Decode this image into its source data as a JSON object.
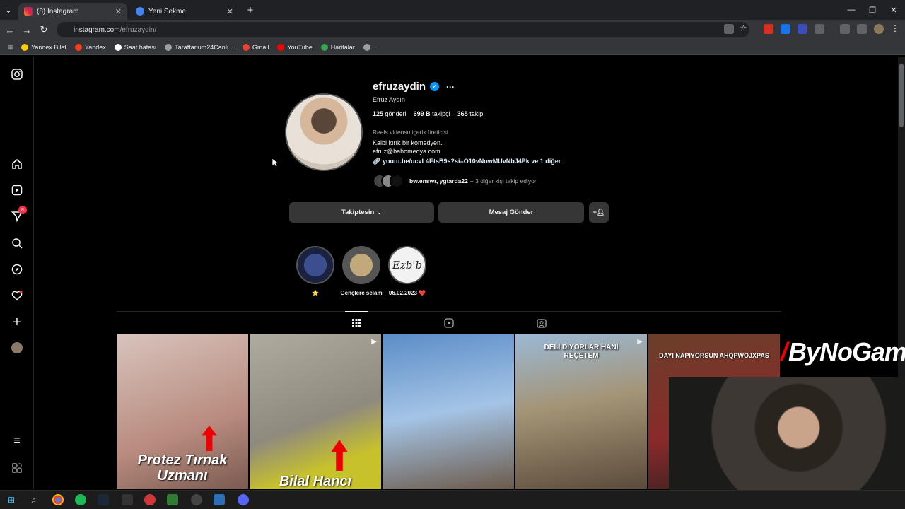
{
  "browser": {
    "tabs": [
      {
        "title": "(8) Instagram",
        "active": true
      },
      {
        "title": "Yeni Sekme",
        "active": false
      }
    ],
    "url_host": "instagram.com",
    "url_path": "/efruzaydin/",
    "bookmarks": [
      "Yandex.Bilet",
      "Yandex",
      "Saat hatası",
      "Taraftarium24Canlı...",
      "Gmail",
      "YouTube",
      "Haritalar",
      "."
    ]
  },
  "sidebar": {
    "notifications_badge": "8"
  },
  "profile": {
    "username": "efruzaydin",
    "full_name": "Efruz Aydın",
    "posts": "125",
    "posts_label": "gönderi",
    "followers": "699 B",
    "followers_label": "takipçi",
    "following": "365",
    "following_label": "takip",
    "category": "Reels videosu içerik üreticisi",
    "bio_line1": "Kalbi kırık bir komedyen.",
    "bio_line2": "efruz@bahomedya.com",
    "link": "youtu.be/ucvL4EtsB9s?si=O10vNowMUvNbJ4Pk ve 1 diğer",
    "followed_by_names": "bw.enswr, ygtarda22",
    "followed_by_rest": "+ 3 diğer kişi takip ediyor"
  },
  "actions": {
    "following_label": "Takiptesin",
    "message_label": "Mesaj Gönder"
  },
  "highlights": [
    {
      "label": "⭐"
    },
    {
      "label": "Gençlere selam"
    },
    {
      "label": "06.02.2023 ❤️",
      "cover_text": "Ezb'b"
    }
  ],
  "posts": [
    {
      "caption": "Protez Tırnak Uzmanı",
      "bg": "#b98c7f"
    },
    {
      "caption": "Bilal Hancı",
      "bg": "#8f8a7e"
    },
    {
      "caption": "",
      "bg": "#7ea6cf"
    },
    {
      "caption": "DELİ DİYORLAR HANİ REÇETEM",
      "bg": "#a49476"
    },
    {
      "caption": "DAYI NAPIYORSUN AHQPWOJXPAS",
      "bg": "#6a3f2a"
    }
  ],
  "overlay_brand": "ByNoGame"
}
